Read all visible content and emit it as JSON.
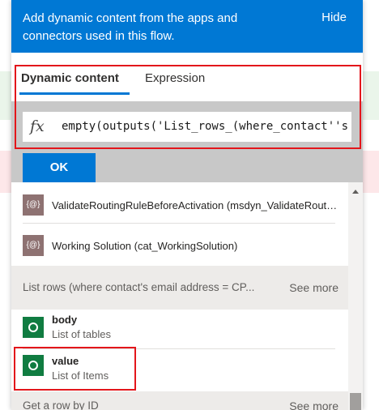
{
  "header": {
    "text": "Add dynamic content from the apps and connectors used in this flow.",
    "hide_label": "Hide"
  },
  "tabs": [
    {
      "label": "Dynamic content",
      "selected": true
    },
    {
      "label": "Expression",
      "selected": false
    }
  ],
  "expression": {
    "fx_symbol": "fx",
    "value": "empty(outputs('List_rows_(where_contact''s"
  },
  "ok_label": "OK",
  "items": [
    {
      "title": "ValidateRoutingRuleBeforeActivation (msdyn_ValidateRoutingRuleBeforeActivation)",
      "icon": "variable-icon",
      "icon_text": "{@}"
    },
    {
      "title": "Working Solution (cat_WorkingSolution)",
      "icon": "variable-icon",
      "icon_text": "{@}"
    }
  ],
  "group1": {
    "title": "List rows (where contact's email address = CP...",
    "see_more": "See more",
    "items": [
      {
        "title": "body",
        "subtitle": "List of tables",
        "icon": "dataverse-icon"
      },
      {
        "title": "value",
        "subtitle": "List of Items",
        "icon": "dataverse-icon"
      }
    ]
  },
  "group2": {
    "title": "Get a row by ID",
    "see_more": "See more"
  },
  "colors": {
    "accent": "#0078d4",
    "highlight_border": "#e3161b",
    "dataverse_green": "#107c41"
  }
}
